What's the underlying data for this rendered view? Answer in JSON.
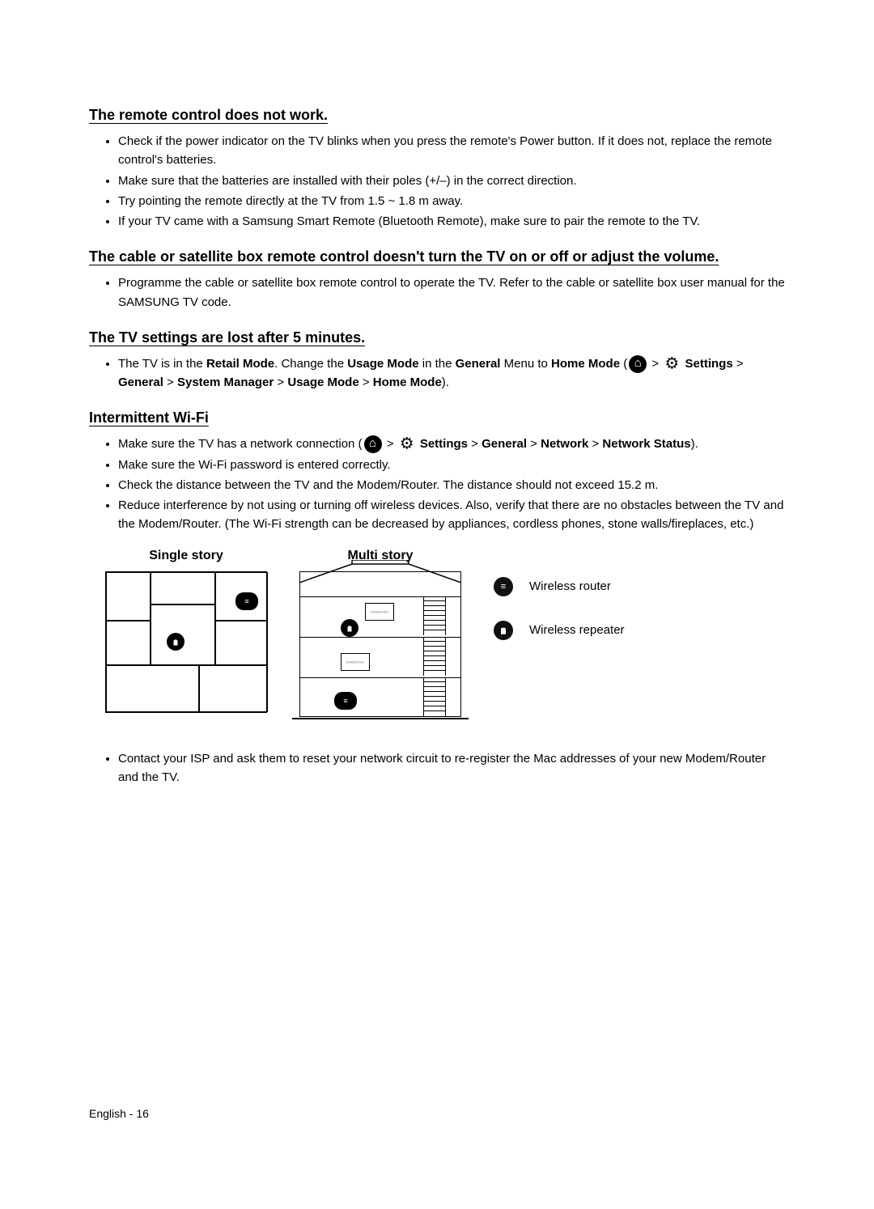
{
  "sections": {
    "remote": {
      "heading": "The remote control does not work.",
      "bullets": [
        "Check if the power indicator on the TV blinks when you press the remote's Power button. If it does not, replace the remote control's batteries.",
        "Make sure that the batteries are installed with their poles (+/–) in the correct direction.",
        "Try pointing the remote directly at the TV from 1.5 ~ 1.8 m away.",
        "If your TV came with a Samsung Smart Remote (Bluetooth Remote), make sure to pair the remote to the TV."
      ]
    },
    "cable": {
      "heading": "The cable or satellite box remote control doesn't turn the TV on or off or adjust the volume.",
      "bullets": [
        "Programme the cable or satellite box remote control to operate the TV. Refer to the cable or satellite box user manual for the SAMSUNG TV code."
      ]
    },
    "settings": {
      "heading": "The TV settings are lost after 5 minutes.",
      "intro_pre": "The TV is in the ",
      "retail_mode": "Retail Mode",
      "intro_mid1": ". Change the ",
      "usage_mode": "Usage Mode",
      "intro_mid2": " in the ",
      "general": "General",
      "intro_mid3": " Menu to ",
      "home_mode": "Home Mode",
      "intro_mid4": " (",
      "nav_sep": " > ",
      "nav_settings": "Settings",
      "nav_general": "General",
      "nav_system_manager": "System Manager",
      "nav_usage_mode": "Usage Mode",
      "nav_home_mode": "Home Mode",
      "intro_end": ")."
    },
    "wifi": {
      "heading": "Intermittent Wi-Fi",
      "b1_pre": "Make sure the TV has a network connection (",
      "nav_sep": " > ",
      "nav_settings": "Settings",
      "nav_general": "General",
      "nav_network": "Network",
      "nav_network_status": "Network Status",
      "b1_end": ").",
      "b2": "Make sure the Wi-Fi password is entered correctly.",
      "b3": "Check the distance between the TV and the Modem/Router. The distance should not exceed 15.2 m.",
      "b4": "Reduce interference by not using or turning off wireless devices. Also, verify that there are no obstacles between the TV and the Modem/Router. (The Wi-Fi strength can be decreased by appliances, cordless phones, stone walls/fireplaces, etc.)"
    },
    "diagrams": {
      "single_label": "Single story",
      "multi_label": "Multi story",
      "legend_router": "Wireless router",
      "legend_repeater": "Wireless repeater"
    },
    "contact": {
      "bullet": "Contact your ISP and ask them to reset your network circuit to re-register the Mac addresses of your new Modem/Router and the TV."
    }
  },
  "footer": "English - 16"
}
